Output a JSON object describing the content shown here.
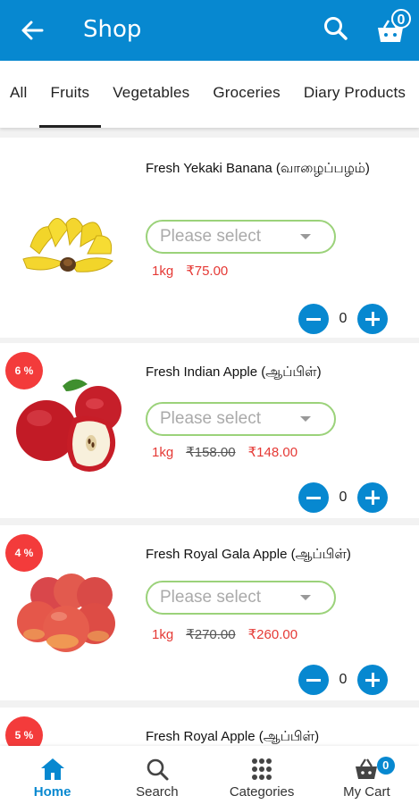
{
  "appbar": {
    "title": "Shop",
    "cart_count": "0"
  },
  "tabs": [
    {
      "label": "All"
    },
    {
      "label": "Fruits",
      "active": true
    },
    {
      "label": "Vegetables"
    },
    {
      "label": "Groceries"
    },
    {
      "label": "Diary Products"
    }
  ],
  "products": [
    {
      "name": "Fresh Yekaki Banana (வாழைப்பழம்)",
      "select_placeholder": "Please select",
      "unit": "1kg",
      "price": "₹75.00",
      "old_price": "",
      "quantity": "0",
      "discount": ""
    },
    {
      "name": "Fresh Indian Apple (ஆப்பிள்)",
      "select_placeholder": "Please select",
      "unit": "1kg",
      "price": "₹148.00",
      "old_price": "₹158.00",
      "quantity": "0",
      "discount": "6 %"
    },
    {
      "name": "Fresh Royal Gala Apple (ஆப்பிள்)",
      "select_placeholder": "Please select",
      "unit": "1kg",
      "price": "₹260.00",
      "old_price": "₹270.00",
      "quantity": "0",
      "discount": "4 %"
    },
    {
      "name": "Fresh Royal Apple (ஆப்பிள்)",
      "discount": "5 %"
    }
  ],
  "bottom_nav": [
    {
      "label": "Home",
      "icon": "home-icon",
      "active": true
    },
    {
      "label": "Search",
      "icon": "search-icon"
    },
    {
      "label": "Categories",
      "icon": "grid-icon"
    },
    {
      "label": "My Cart",
      "icon": "basket-icon",
      "badge": "0"
    }
  ],
  "colors": {
    "primary": "#0788d0",
    "accent_green": "#9bd27a",
    "price_red": "#e53935",
    "discount_red": "#f33b3b"
  }
}
